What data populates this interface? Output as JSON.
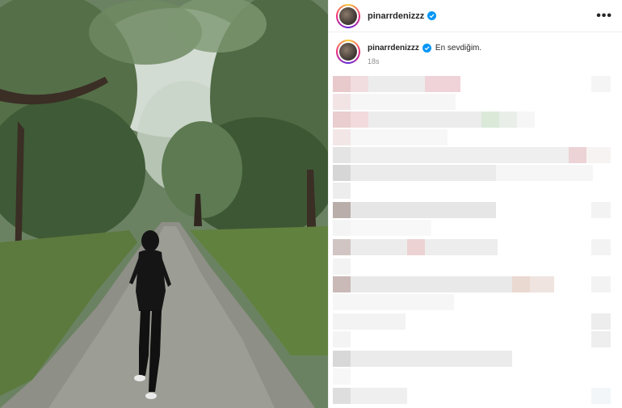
{
  "post": {
    "username": "pinarrdenizzz",
    "caption": "En sevdiğim.",
    "timestamp": "18s"
  },
  "icons": {
    "verified": "verified-badge-icon",
    "more": "more-options-icon"
  },
  "colors": {
    "verified_blue": "#0095f6",
    "text": "#262626",
    "muted": "#8e8e8e"
  }
}
